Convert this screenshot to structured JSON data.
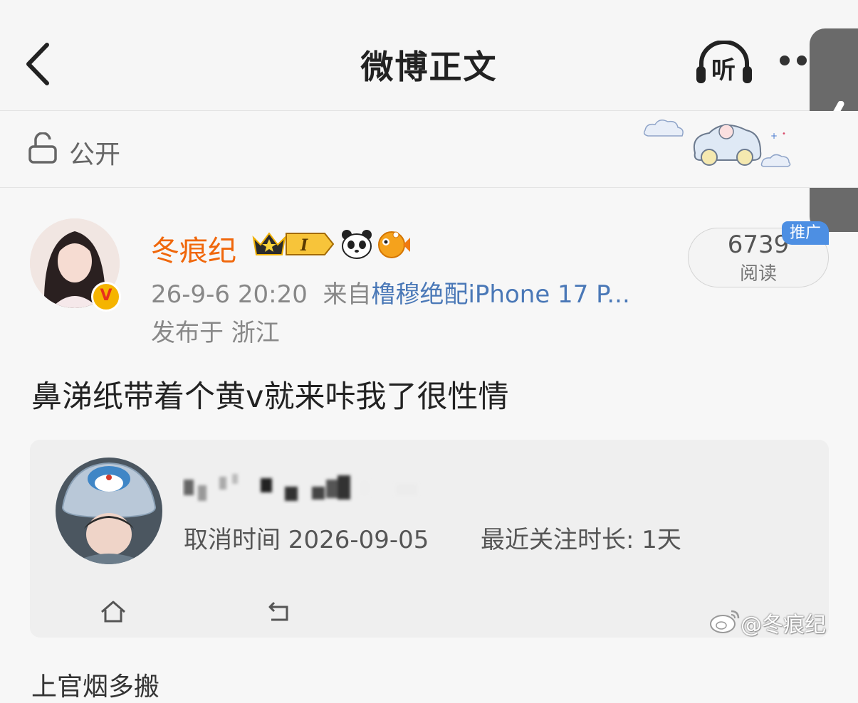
{
  "header": {
    "title": "微博正文",
    "listen_label": "听"
  },
  "visibility": {
    "label": "公开"
  },
  "post": {
    "username": "冬痕纪",
    "member_level": "I",
    "timestamp": "26-9-6 20:20",
    "source_prefix": "来自",
    "source_device": "橹穆绝配iPhone 17 P...",
    "location": "发布于 浙江",
    "read_count": "6739",
    "read_label": "阅读",
    "promo_badge": "推广",
    "content": "鼻涕纸带着个黄v就来咔我了很性情"
  },
  "embedded_card": {
    "cancel_time": "取消时间 2026-09-05",
    "follow_duration": "最近关注时长: 1天"
  },
  "watermark": "@冬痕纪",
  "bottom_text": "上官烟多搬",
  "colors": {
    "username": "#f0670b",
    "device_link": "#4a78b7",
    "promo_badge": "#4d8fe3",
    "verified_badge": "#f5b400",
    "side_tab": "#6a6a6a"
  },
  "icons": [
    "back-arrow-icon",
    "headphones-icon",
    "more-dots-icon",
    "lock-icon",
    "verified-v-icon",
    "crown-badge-icon",
    "panda-icon",
    "fish-icon",
    "home-icon",
    "return-icon",
    "weibo-logo-icon",
    "chevron-left-icon"
  ]
}
